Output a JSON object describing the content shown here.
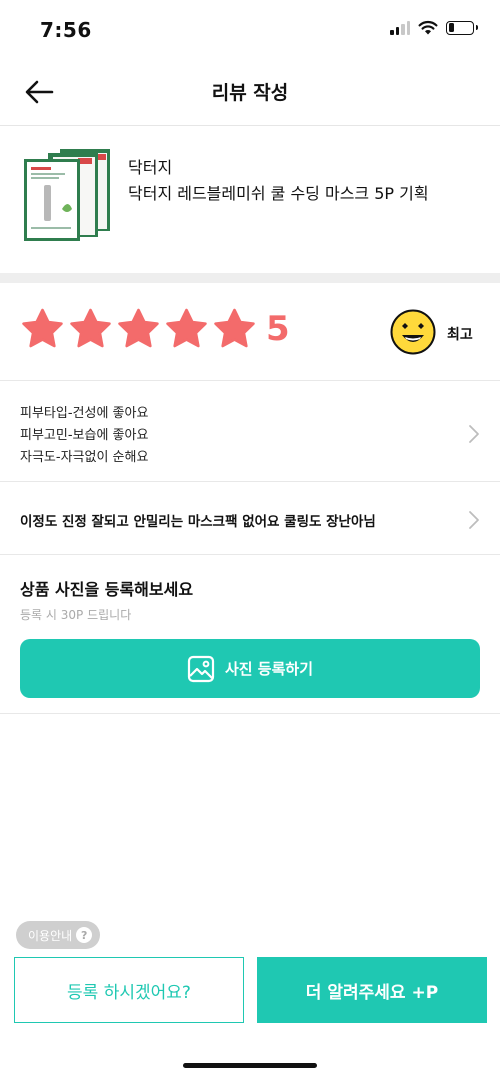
{
  "status_bar": {
    "time": "7:56",
    "signal_bars": 4,
    "signal_bars_active": 2,
    "battery_level_percent": 25,
    "icons": [
      "signal-icon",
      "wifi-icon",
      "battery-icon"
    ]
  },
  "header": {
    "title": "리뷰 작성",
    "back_icon": "back-arrow-icon"
  },
  "product": {
    "brand": "닥터지",
    "name": "닥터지 레드블레미쉬 쿨 수딩 마스크 5P 기획"
  },
  "rating": {
    "stars_filled": 5,
    "stars_total": 5,
    "score": "5",
    "label": "최고",
    "emoji_icon": "grinning-face-icon",
    "star_color": "#f36b6b"
  },
  "attributes": {
    "lines": [
      "피부타입-건성에 좋아요",
      "피부고민-보습에 좋아요",
      "자극도-자극없이 순해요"
    ]
  },
  "comment": {
    "text": "이정도 진정 잘되고 안밀리는 마스크팩 없어요 쿨링도 장난아님"
  },
  "photo": {
    "title": "상품 사진을 등록해보세요",
    "subtitle": "등록 시 30P 드립니다",
    "button_label": "사진 등록하기",
    "button_icon": "image-icon"
  },
  "usage_guide": {
    "label": "이용안내",
    "icon_glyph": "?"
  },
  "bottom_buttons": {
    "register_label": "등록 하시겠어요?",
    "more_label": "더 알려주세요 +P"
  },
  "colors": {
    "accent": "#1fc8b2",
    "star": "#f36b6b",
    "emoji": "#ffd93b"
  }
}
